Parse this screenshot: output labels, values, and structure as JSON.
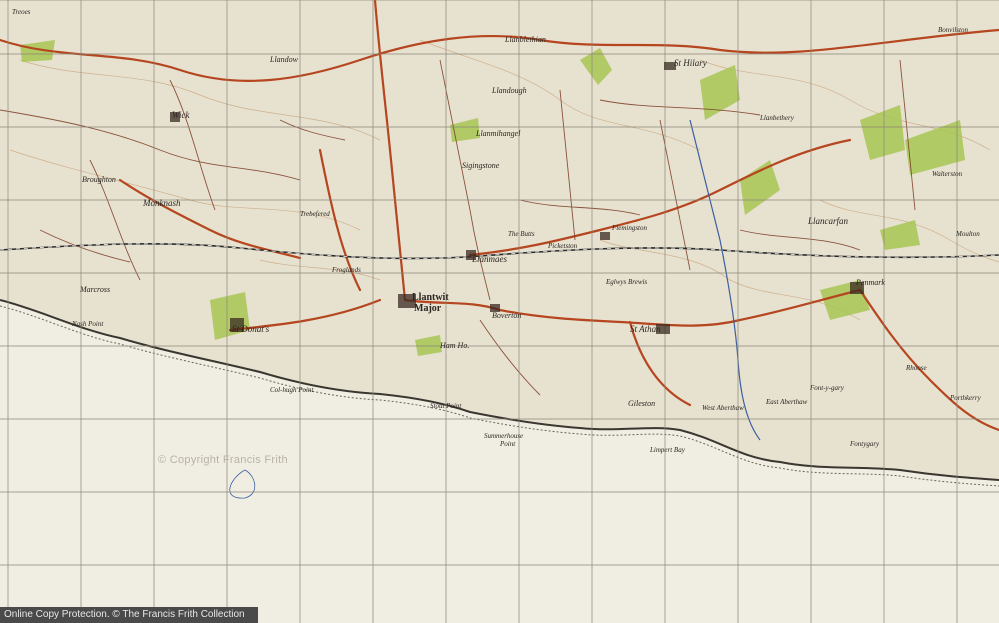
{
  "map": {
    "colors": {
      "paper": "#e7e1d0",
      "sea": "#f0ede2",
      "road": "#b5461f",
      "minor_road": "#7a3a22",
      "woodland": "#a7c653",
      "grid": "#8a8676",
      "railway": "#2b2b2b",
      "contour": "#c9a57a"
    },
    "places": [
      {
        "id": "llantwit-major",
        "name": "Llantwit"
      },
      {
        "id": "llantwit-major-2",
        "name": "Major"
      },
      {
        "id": "llanmaes",
        "name": "Llanmaes"
      },
      {
        "id": "boverton",
        "name": "Boverton"
      },
      {
        "id": "st-donats",
        "name": "St Donat's"
      },
      {
        "id": "st-athan",
        "name": "St Athan"
      },
      {
        "id": "gileston",
        "name": "Gileston"
      },
      {
        "id": "llancarfan",
        "name": "Llancarfan"
      },
      {
        "id": "penmark",
        "name": "Penmark"
      },
      {
        "id": "st-hilary",
        "name": "St Hilary"
      },
      {
        "id": "llandough",
        "name": "Llandough"
      },
      {
        "id": "llanblethian",
        "name": "Llanblethian"
      },
      {
        "id": "llanmihangel",
        "name": "Llanmihangel"
      },
      {
        "id": "sigingstone",
        "name": "Sigingstone"
      },
      {
        "id": "monknash",
        "name": "Monknash"
      },
      {
        "id": "broughton",
        "name": "Broughton"
      },
      {
        "id": "marcross",
        "name": "Marcross"
      },
      {
        "id": "wick",
        "name": "Wick"
      },
      {
        "id": "llandow",
        "name": "Llandow"
      },
      {
        "id": "eglwys-brewis",
        "name": "Eglwys Brewis"
      },
      {
        "id": "flemingston",
        "name": "Flemingston"
      },
      {
        "id": "east-aberthaw",
        "name": "East Aberthaw"
      },
      {
        "id": "west-aberthaw",
        "name": "West Aberthaw"
      },
      {
        "id": "the-butts",
        "name": "The Butts"
      },
      {
        "id": "picketston",
        "name": "Picketston"
      },
      {
        "id": "nash-point",
        "name": "Nash Point"
      },
      {
        "id": "ham",
        "name": "Ham Ho."
      },
      {
        "id": "walterston",
        "name": "Walterston"
      },
      {
        "id": "moulton",
        "name": "Moulton"
      },
      {
        "id": "porthkerry",
        "name": "Porthkerry"
      },
      {
        "id": "fontygary",
        "name": "Fontygary"
      },
      {
        "id": "bonvilston",
        "name": "Bonvilston"
      },
      {
        "id": "treoes",
        "name": "Treoes"
      },
      {
        "id": "llanbethery",
        "name": "Llanbethery"
      },
      {
        "id": "rhoose",
        "name": "Rhoose"
      },
      {
        "id": "font-y-gary",
        "name": "Font-y-gary"
      },
      {
        "id": "trebefered",
        "name": "Trebefered"
      },
      {
        "id": "froglands",
        "name": "Froglands"
      }
    ],
    "coast_labels": [
      {
        "id": "col-hugh-point",
        "name": "Col-hugh Point"
      },
      {
        "id": "summerhouse-point",
        "name": "Summerhouse"
      },
      {
        "id": "summerhouse-point-2",
        "name": "Point"
      },
      {
        "id": "stout-point",
        "name": "Stout Point"
      },
      {
        "id": "limpert-bay",
        "name": "Limpert Bay"
      }
    ]
  },
  "watermark": "© Copyright Francis Frith",
  "footer": "Online Copy Protection. © The Francis Frith Collection"
}
